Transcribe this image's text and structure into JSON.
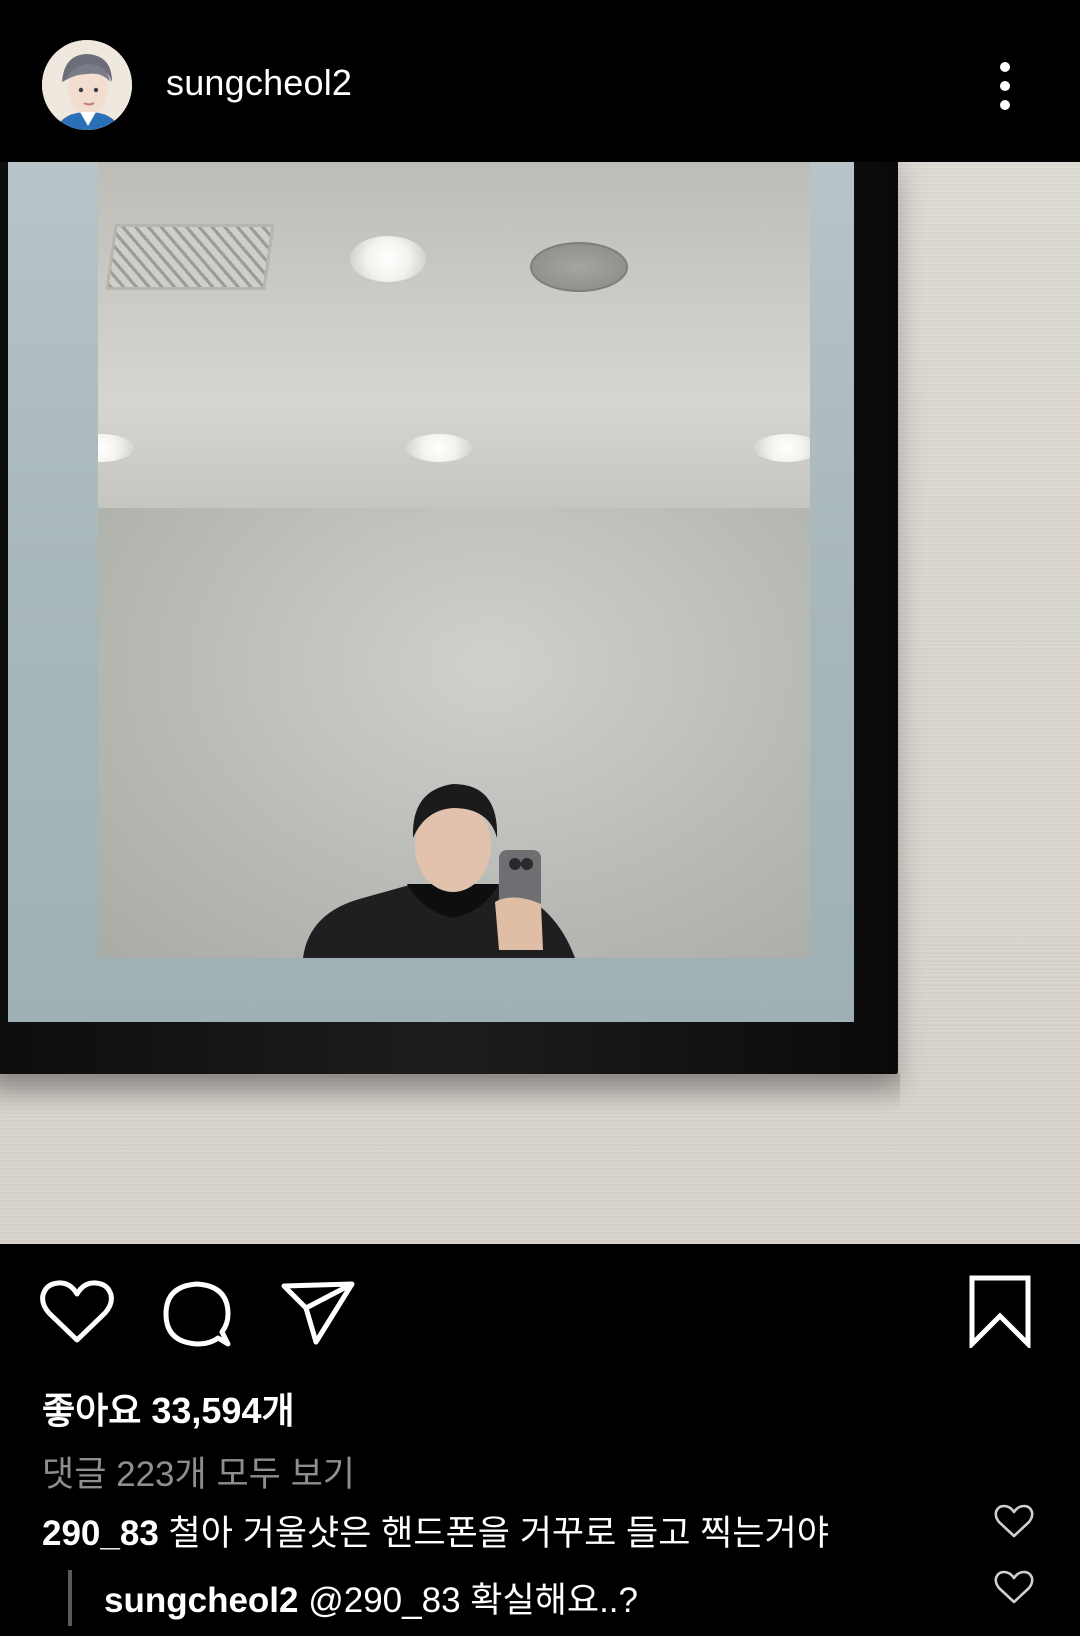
{
  "header": {
    "username": "sungcheol2",
    "more_icon": "more-vertical-icon"
  },
  "post": {
    "image_description_icon": "photo"
  },
  "actions": {
    "like_icon": "heart-icon",
    "comment_icon": "comment-bubble-icon",
    "share_icon": "paper-plane-icon",
    "save_icon": "bookmark-icon"
  },
  "stats": {
    "likes_text": "좋아요 33,594개",
    "view_comments_text": "댓글 223개 모두 보기"
  },
  "comments": [
    {
      "user": "290_83",
      "text": "철아 거울샷은 핸드폰을 거꾸로 들고 찍는거야"
    },
    {
      "user": "sungcheol2",
      "text": "@290_83 확실해요..?"
    }
  ],
  "colors": {
    "background": "#000000",
    "text": "#ffffff",
    "muted": "#8e8e8e"
  }
}
